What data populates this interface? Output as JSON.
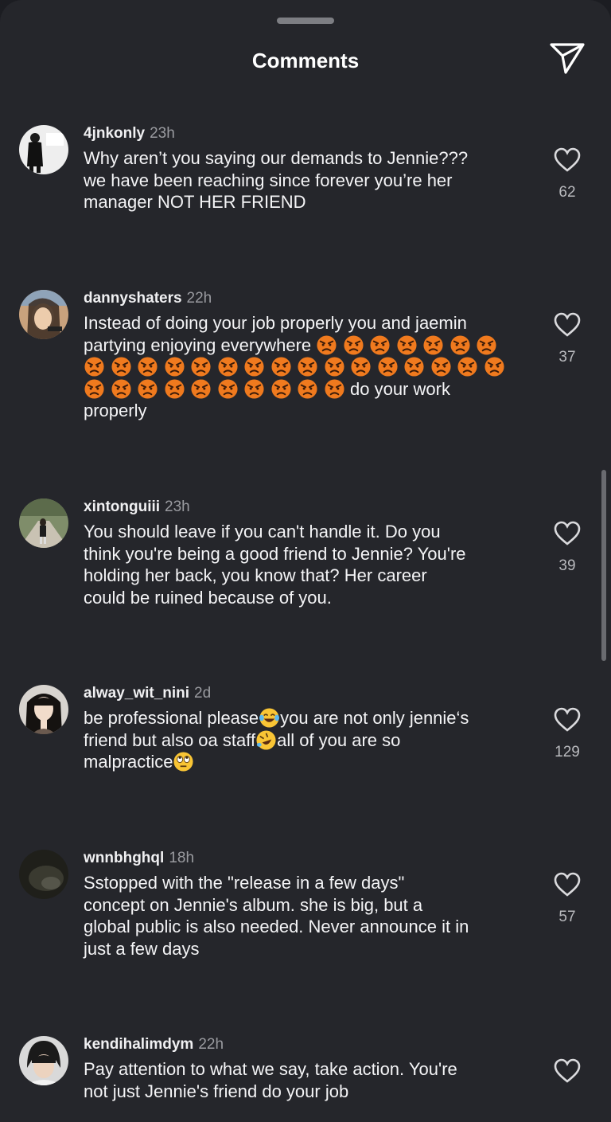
{
  "header": {
    "title": "Comments",
    "share_icon": "paper-plane-icon"
  },
  "comments": [
    {
      "username": "4jnkonly",
      "time": "23h",
      "text": "Why aren’t you saying our demands to Jennie???\nwe have been reaching since forever you’re her\nmanager NOT HER FRIEND",
      "likes": "62"
    },
    {
      "username": "dannyshaters",
      "time": "22h",
      "text_before": "Instead of doing your job properly you and jaemin\npartying enjoying everywhere",
      "text_after": "do your work\nproperly",
      "emoji": "angry-face-emoji",
      "emoji_count": 33,
      "likes": "37"
    },
    {
      "username": "xintonguiii",
      "time": "23h",
      "text": "You should leave if you can't handle it. Do you\nthink you're being a good friend to Jennie? You're\nholding her back, you know that? Her career\ncould be ruined because of you.",
      "likes": "39"
    },
    {
      "username": "alway_wit_nini",
      "time": "2d",
      "text_1": "be professional please",
      "text_2": "you are not only jennie‘s\nfriend but also oa staff",
      "text_3": "all of you are so\nmalpractice",
      "emojis": [
        "tears-of-joy-emoji",
        "rolling-laughing-emoji",
        "eye-roll-emoji"
      ],
      "likes": "129"
    },
    {
      "username": "wnnbhghql",
      "time": "18h",
      "text": "Sstopped with the \"release in a few days\"\nconcept on Jennie's album. she is big, but a\nglobal public is also needed. Never announce it in\njust a few days",
      "likes": "57"
    },
    {
      "username": "kendihalimdym",
      "time": "22h",
      "text": "Pay attention to what we say, take action. You're\nnot just Jennie's friend do your job",
      "likes": ""
    }
  ],
  "colors": {
    "background": "#25262b",
    "text": "#f4f4f6",
    "muted": "#9a9ba0",
    "emoji_angry": "#f07a1e"
  }
}
